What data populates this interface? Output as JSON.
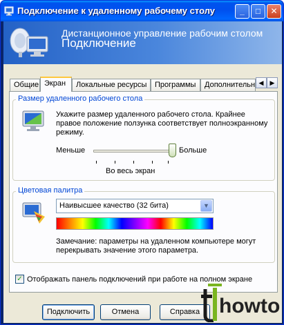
{
  "window": {
    "title": "Подключение к удаленному рабочему столу",
    "controls": {
      "minimize": "_",
      "maximize": "□",
      "close": "✕"
    }
  },
  "banner": {
    "subtitle": "Дистанционное управление рабочим столом",
    "title": "Подключение"
  },
  "tabs": [
    {
      "label": "Общие",
      "active": false
    },
    {
      "label": "Экран",
      "active": true
    },
    {
      "label": "Локальные ресурсы",
      "active": false
    },
    {
      "label": "Программы",
      "active": false
    },
    {
      "label": "Дополнительно",
      "active": false
    }
  ],
  "tab_scroll": {
    "left": "◀",
    "right": "▶"
  },
  "screen_size": {
    "title": "Размер удаленного рабочего стола",
    "description": "Укажите размер удаленного рабочего стола. Крайнее правое положение ползунка соответствует полноэкранному режиму.",
    "min_label": "Меньше",
    "max_label": "Больше",
    "value_label": "Во весь экран",
    "slider_fraction": 1.0
  },
  "colors": {
    "title": "Цветовая палитра",
    "selected": "Наивысшее качество (32 бита)",
    "note": "Замечание: параметры на удаленном компьютере могут перекрывать значение этого параметра."
  },
  "fullscreen_bar": {
    "label": "Отображать панель подключений при работе на полном экране",
    "checked": true,
    "check_glyph": "✓"
  },
  "buttons": {
    "connect": "Подключить",
    "cancel": "Отмена",
    "help": "Справка"
  },
  "watermark": {
    "text": "howto"
  },
  "theme": {
    "accent": "#0046d5",
    "titlebar": "#0054e3",
    "dialog_bg": "#ece9d8"
  }
}
